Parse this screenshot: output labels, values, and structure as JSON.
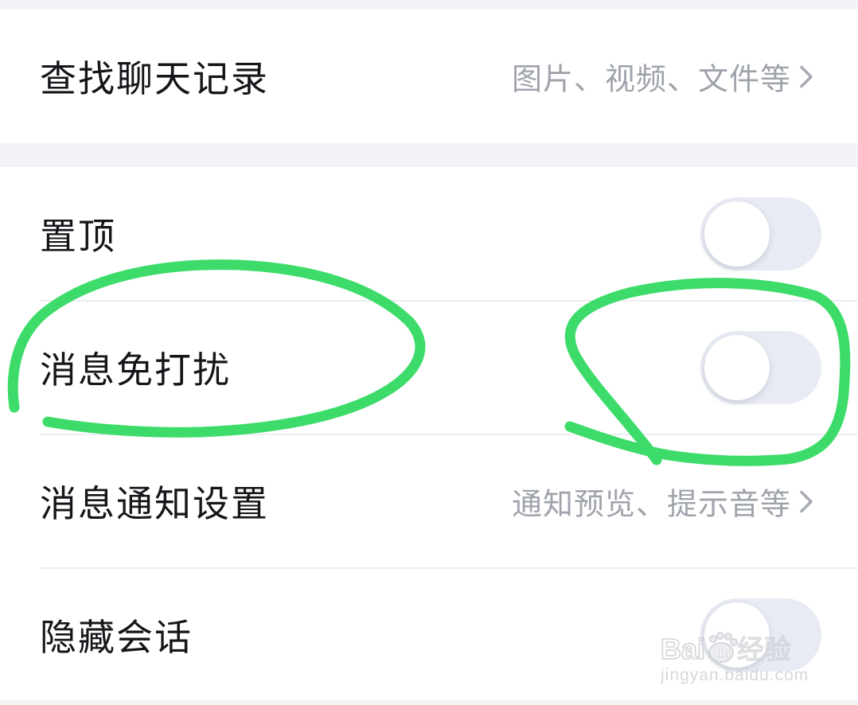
{
  "rows": {
    "search_history": {
      "label": "查找聊天记录",
      "detail": "图片、视频、文件等"
    },
    "pin_chat": {
      "label": "置顶",
      "enabled": false
    },
    "do_not_disturb": {
      "label": "消息免打扰",
      "enabled": false
    },
    "notification_settings": {
      "label": "消息通知设置",
      "detail": "通知预览、提示音等"
    },
    "hide_chat": {
      "label": "隐藏会话",
      "enabled": false
    }
  },
  "annotation": {
    "color": "#3ddc6a"
  },
  "watermark": {
    "brand": "Baidu经验",
    "url": "jingyan.baidu.com"
  },
  "colors": {
    "page_bg": "#f2f3f7",
    "card_bg": "#ffffff",
    "label": "#14161a",
    "detail": "#9fa3ab",
    "toggle_off": "#e8ebf3"
  }
}
